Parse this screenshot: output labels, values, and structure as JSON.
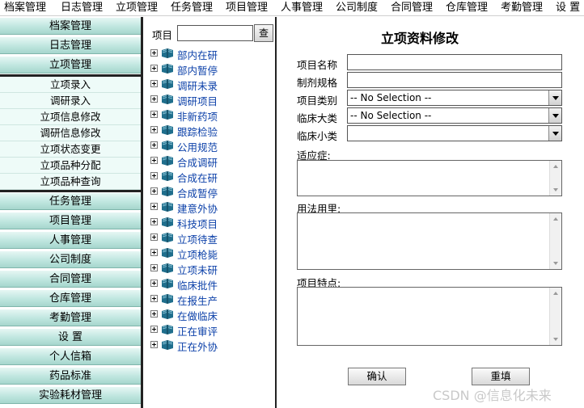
{
  "top_menu": [
    "档案管理",
    "日志管理",
    "立项管理",
    "任务管理",
    "项目管理",
    "人事管理",
    "公司制度",
    "合同管理",
    "仓库管理",
    "考勤管理",
    "设 置"
  ],
  "sidebar": {
    "top_categories": [
      "档案管理",
      "日志管理",
      "立项管理"
    ],
    "sub_items": [
      "立项录入",
      "调研录入",
      "立项信息修改",
      "调研信息修改",
      "立项状态变更",
      "立项品种分配",
      "立项品种查询"
    ],
    "bottom_categories": [
      "任务管理",
      "项目管理",
      "人事管理",
      "公司制度",
      "合同管理",
      "仓库管理",
      "考勤管理",
      "设 置",
      "个人信箱",
      "药品标准",
      "实验耗材管理"
    ]
  },
  "tree": {
    "label": "项目",
    "search_value": "",
    "search_button": "查",
    "items": [
      "部内在研",
      "部内暂停",
      "调研未录",
      "调研项目",
      "非新药项",
      "跟踪检验",
      "公用规范",
      "合成调研",
      "合成在研",
      "合成暂停",
      "建意外协",
      "科技项目",
      "立项待查",
      "立项枪毙",
      "立项未研",
      "临床批件",
      "在报生产",
      "在做临床",
      "正在审评",
      "正在外协"
    ]
  },
  "form": {
    "title": "立项资料修改",
    "fields": {
      "name_label": "项目名称",
      "name_value": "",
      "spec_label": "制剂规格",
      "spec_value": "",
      "category_label": "项目类别",
      "category_value": "-- No Selection --",
      "clinical_major_label": "临床大类",
      "clinical_major_value": "-- No Selection --",
      "clinical_minor_label": "临床小类",
      "clinical_minor_value": ""
    },
    "indication_label": "适应症:",
    "dosage_label": "用法用里:",
    "features_label": "项目特点:",
    "confirm_button": "确认",
    "reset_button": "重填"
  },
  "watermark": "CSDN @信息化未来",
  "colors": {
    "sidebar_gradient_top": "#e6f7f4",
    "sidebar_gradient_bottom": "#a6d6cd",
    "tree_link": "#0a3fa8",
    "book_icon": "#1f6e8c"
  }
}
